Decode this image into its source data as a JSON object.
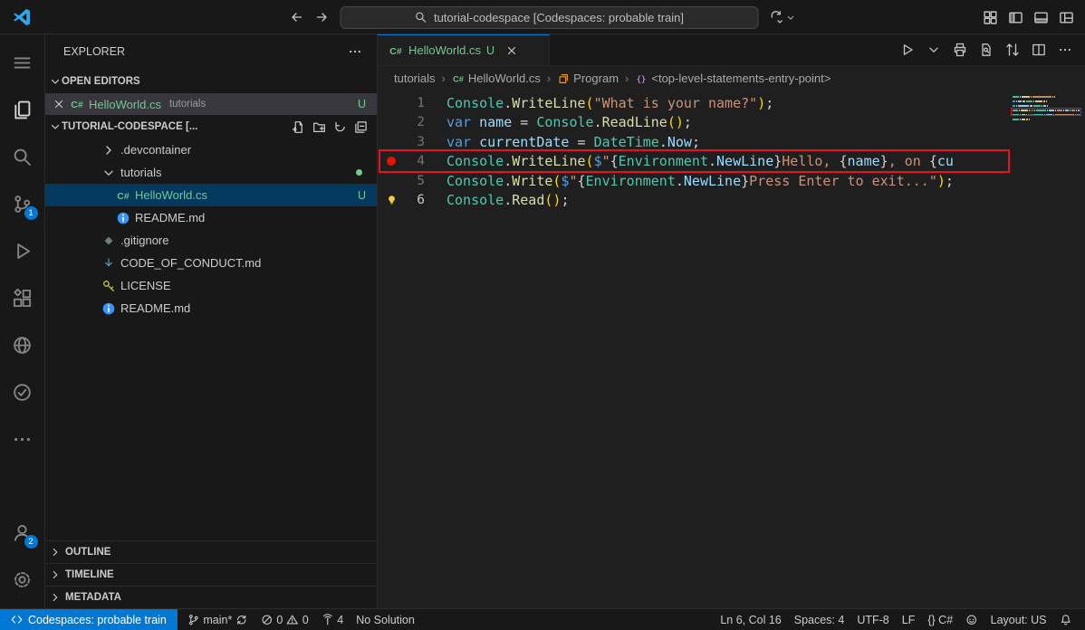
{
  "colors": {
    "accent": "#0078d4",
    "untracked_green": "#73C991",
    "breakpoint_red": "#e51400",
    "annotation_red": "#e81123"
  },
  "title_bar": {
    "search_text": "tutorial-codespace [Codespaces: probable train]",
    "nav_icons": [
      "arrow-left-icon",
      "arrow-right-icon"
    ],
    "layout_icons": [
      "grid-icon",
      "toggle-sidebar-icon",
      "toggle-panel-icon",
      "customize-layout-icon"
    ]
  },
  "activity_bar": {
    "top": [
      {
        "id": "menu",
        "icon": "menu-icon"
      },
      {
        "id": "explorer",
        "icon": "files-icon",
        "active": true
      },
      {
        "id": "search",
        "icon": "search-icon"
      },
      {
        "id": "source-control",
        "icon": "source-control-icon",
        "badge": "1"
      },
      {
        "id": "run-debug",
        "icon": "debug-icon"
      },
      {
        "id": "extensions",
        "icon": "extensions-icon"
      },
      {
        "id": "remote-explorer",
        "icon": "globe-icon"
      },
      {
        "id": "testing",
        "icon": "check-circle-icon"
      },
      {
        "id": "more",
        "icon": "ellipsis-icon"
      }
    ],
    "bottom": [
      {
        "id": "accounts",
        "icon": "account-icon",
        "badge": "2"
      },
      {
        "id": "settings",
        "icon": "gear-icon"
      }
    ]
  },
  "sidebar": {
    "title": "EXPLORER",
    "open_editors": {
      "header": "OPEN EDITORS",
      "item": {
        "name": "HelloWorld.cs",
        "detail": "tutorials",
        "badge": "U"
      }
    },
    "workspace": {
      "header": "TUTORIAL-CODESPACE [...",
      "action_icons": [
        "new-file-icon",
        "new-folder-icon",
        "refresh-icon",
        "collapse-all-icon"
      ]
    },
    "tree": [
      {
        "label": ".devcontainer",
        "kind": "folder",
        "chevron": "right",
        "level": 0
      },
      {
        "label": "tutorials",
        "kind": "folder",
        "chevron": "down",
        "level": 0,
        "change_dot": true
      },
      {
        "label": "HelloWorld.cs",
        "icon": "csharp-icon",
        "level": 1,
        "selected": true,
        "badge": "U",
        "git": "untracked"
      },
      {
        "label": "README.md",
        "icon": "info-icon",
        "level": 1
      },
      {
        "label": ".gitignore",
        "icon": "git-icon",
        "level": 0
      },
      {
        "label": "CODE_OF_CONDUCT.md",
        "icon": "markdown-icon",
        "level": 0
      },
      {
        "label": "LICENSE",
        "icon": "license-icon",
        "level": 0
      },
      {
        "label": "README.md",
        "icon": "info-icon",
        "level": 0
      }
    ],
    "panels": [
      "OUTLINE",
      "TIMELINE",
      "METADATA"
    ]
  },
  "editor": {
    "tab": {
      "label": "HelloWorld.cs",
      "badge": "U"
    },
    "tab_action_icons": [
      "run-icon",
      "chevron-down-icon",
      "print-icon",
      "search-doc-icon",
      "compare-icon",
      "split-editor-icon",
      "ellipsis-icon"
    ],
    "breadcrumbs": [
      {
        "label": "tutorials"
      },
      {
        "label": "HelloWorld.cs",
        "icon": "csharp-icon"
      },
      {
        "label": "Program",
        "icon": "symbol-class-icon"
      },
      {
        "label": "<top-level-statements-entry-point>",
        "icon": "symbol-namespace-icon"
      }
    ],
    "token_colors": {
      "cls": "#4EC9B0",
      "fn": "#DCDCAA",
      "str": "#CE9178",
      "kw": "#569CD6",
      "var": "#9CDCFE",
      "punc": "#D4D4D4",
      "br": "#FFD700"
    },
    "lines": [
      {
        "num": "1",
        "tokens": [
          [
            "Console",
            "cls"
          ],
          [
            ".",
            "punc"
          ],
          [
            "WriteLine",
            "fn"
          ],
          [
            "(",
            "br"
          ],
          [
            "\"What is your name?\"",
            "str"
          ],
          [
            ")",
            "br"
          ],
          [
            ";",
            "punc"
          ]
        ]
      },
      {
        "num": "2",
        "tokens": [
          [
            "var",
            "kw"
          ],
          [
            " ",
            "punc"
          ],
          [
            "name",
            "var"
          ],
          [
            " = ",
            "punc"
          ],
          [
            "Console",
            "cls"
          ],
          [
            ".",
            "punc"
          ],
          [
            "ReadLine",
            "fn"
          ],
          [
            "()",
            "br"
          ],
          [
            ";",
            "punc"
          ]
        ]
      },
      {
        "num": "3",
        "tokens": [
          [
            "var",
            "kw"
          ],
          [
            " ",
            "punc"
          ],
          [
            "currentDate",
            "var"
          ],
          [
            " = ",
            "punc"
          ],
          [
            "DateTime",
            "cls"
          ],
          [
            ".",
            "punc"
          ],
          [
            "Now",
            "var"
          ],
          [
            ";",
            "punc"
          ]
        ]
      },
      {
        "num": "4",
        "breakpoint": true,
        "annotated": true,
        "tokens": [
          [
            "Console",
            "cls"
          ],
          [
            ".",
            "punc"
          ],
          [
            "WriteLine",
            "fn"
          ],
          [
            "(",
            "br"
          ],
          [
            "$",
            "kw"
          ],
          [
            "\"",
            "str"
          ],
          [
            "{",
            "punc"
          ],
          [
            "Environment",
            "cls"
          ],
          [
            ".",
            "punc"
          ],
          [
            "NewLine",
            "var"
          ],
          [
            "}",
            "punc"
          ],
          [
            "Hello, ",
            "str"
          ],
          [
            "{",
            "punc"
          ],
          [
            "name",
            "var"
          ],
          [
            "}",
            "punc"
          ],
          [
            ", on ",
            "str"
          ],
          [
            "{",
            "punc"
          ],
          [
            "cu",
            "var"
          ]
        ]
      },
      {
        "num": "5",
        "tokens": [
          [
            "Console",
            "cls"
          ],
          [
            ".",
            "punc"
          ],
          [
            "Write",
            "fn"
          ],
          [
            "(",
            "br"
          ],
          [
            "$",
            "kw"
          ],
          [
            "\"",
            "str"
          ],
          [
            "{",
            "punc"
          ],
          [
            "Environment",
            "cls"
          ],
          [
            ".",
            "punc"
          ],
          [
            "NewLine",
            "var"
          ],
          [
            "}",
            "punc"
          ],
          [
            "Press Enter to exit...",
            "str"
          ],
          [
            "\"",
            "str"
          ],
          [
            ")",
            "br"
          ],
          [
            ";",
            "punc"
          ]
        ]
      },
      {
        "num": "6",
        "active": true,
        "lightbulb": true,
        "tokens": [
          [
            "Console",
            "cls"
          ],
          [
            ".",
            "punc"
          ],
          [
            "Read",
            "fn"
          ],
          [
            "()",
            "br"
          ],
          [
            ";",
            "punc"
          ]
        ]
      }
    ]
  },
  "status_bar": {
    "remote": {
      "icon": "remote-icon",
      "label": "Codespaces: probable train"
    },
    "left": [
      {
        "name": "branch",
        "icon": "branch-icon",
        "label": "main*",
        "icon_after": "sync-icon"
      },
      {
        "name": "problems",
        "parts": [
          {
            "icon": "error-icon",
            "label": "0"
          },
          {
            "icon": "warning-icon",
            "label": "0"
          }
        ]
      },
      {
        "name": "ports",
        "icon": "ports-icon",
        "label": "4"
      },
      {
        "name": "solution",
        "label": "No Solution"
      }
    ],
    "right": [
      {
        "name": "cursor-position",
        "label": "Ln 6, Col 16"
      },
      {
        "name": "indentation",
        "label": "Spaces: 4"
      },
      {
        "name": "encoding",
        "label": "UTF-8"
      },
      {
        "name": "eol",
        "label": "LF"
      },
      {
        "name": "language-mode",
        "label": "{} C#"
      },
      {
        "name": "copilot",
        "icon": "copilot-icon"
      },
      {
        "name": "keyboard-layout",
        "label": "Layout: US"
      },
      {
        "name": "notifications",
        "icon": "bell-icon"
      }
    ]
  }
}
